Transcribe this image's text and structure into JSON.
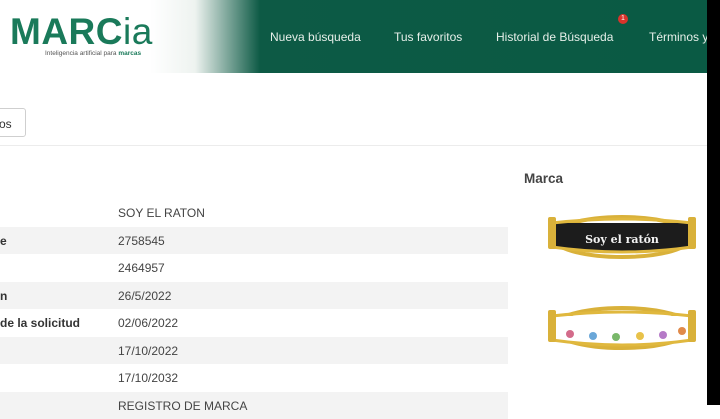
{
  "header": {
    "logo": {
      "name": "MARC",
      "suffix": "ia",
      "tagline_prefix": "Inteligencia artificial para ",
      "tagline_bold": "marcas"
    },
    "nav": [
      {
        "label": "Nueva búsqueda"
      },
      {
        "label": "Tus favoritos"
      },
      {
        "label": "Historial de Búsqueda",
        "badge": "1"
      },
      {
        "label": "Términos y"
      }
    ]
  },
  "toolbar": {
    "button_label": "os"
  },
  "details": {
    "rows": [
      {
        "label": "",
        "value": "SOY EL RATON"
      },
      {
        "label": "e",
        "value": "2758545"
      },
      {
        "label": "",
        "value": "2464957"
      },
      {
        "label": "n",
        "value": "26/5/2022"
      },
      {
        "label": "de la solicitud",
        "value": "02/06/2022"
      },
      {
        "label": "",
        "value": "17/10/2022"
      },
      {
        "label": "",
        "value": "17/10/2032"
      },
      {
        "label": "",
        "value": "REGISTRO DE MARCA"
      }
    ]
  },
  "marca": {
    "title": "Marca",
    "images": [
      {
        "name": "black-bracelet-image",
        "text": "Soy el ratón"
      },
      {
        "name": "white-bracelet-image"
      }
    ]
  },
  "colors": {
    "brand_green": "#0d5a45",
    "logo_green": "#1a7a5a",
    "badge_red": "#d9332b"
  }
}
